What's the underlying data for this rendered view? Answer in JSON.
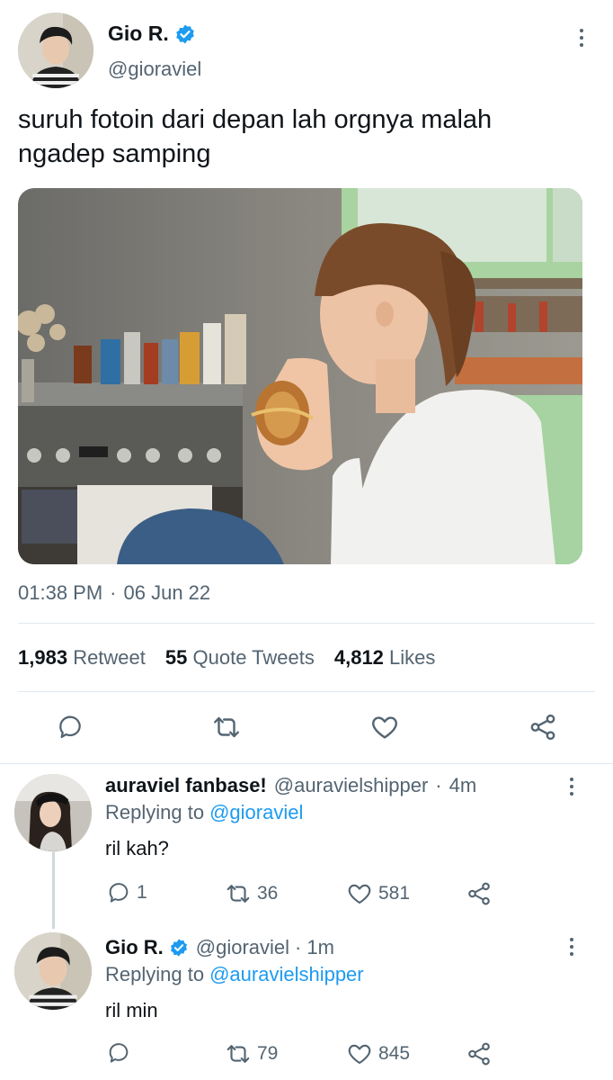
{
  "main_tweet": {
    "name": "Gio R.",
    "handle": "@gioraviel",
    "text_line1": "suruh fotoin dari depan lah orgnya malah",
    "text_line2": "ngadep samping",
    "time": "01:38 PM",
    "separator": "·",
    "date": "06 Jun 22",
    "stats": {
      "retweets": "1,983",
      "retweets_label": "Retweet",
      "quotes": "55",
      "quotes_label": "Quote Tweets",
      "likes": "4,812",
      "likes_label": "Likes"
    }
  },
  "replies": [
    {
      "name": "auraviel fanbase!",
      "handle": "@auravielshipper",
      "separator": "·",
      "age": "4m",
      "replying_prefix": "Replying to",
      "replying_to": "@gioraviel",
      "text": "ril kah?",
      "reply_count": "1",
      "retweet_count": "36",
      "like_count": "581"
    },
    {
      "name": "Gio R.",
      "handle": "@gioraviel",
      "separator": "·",
      "age": "1m",
      "replying_prefix": "Replying to",
      "replying_to": "@auravielshipper",
      "text": "ril min",
      "reply_count": "",
      "retweet_count": "79",
      "like_count": "845"
    }
  ],
  "colors": {
    "accent": "#1d9bf0",
    "muted": "#536471",
    "text": "#0f1419"
  },
  "icons": [
    "verified-badge-icon",
    "more-icon",
    "reply-icon",
    "retweet-icon",
    "like-icon",
    "share-icon"
  ]
}
